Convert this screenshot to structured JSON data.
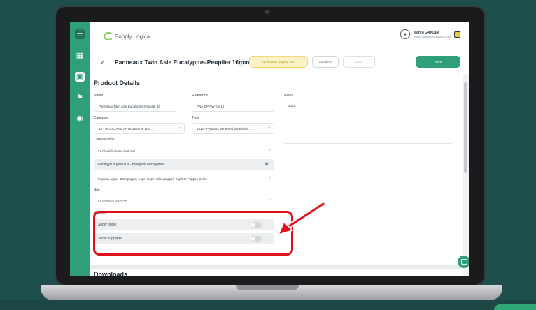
{
  "app": {
    "logo_text": "Supply Logica",
    "user_name": "Marco GANDINI",
    "user_email": "marco.gandini@example.com"
  },
  "colors": {
    "accent": "#2e9f79",
    "background": "#1f4f4c",
    "highlight": "#e0101a"
  },
  "sidebar": {
    "icons": [
      "menu-icon",
      "grid-icon",
      "basket-icon",
      "flag-icon",
      "globe-icon"
    ]
  },
  "header": {
    "back_label": "<",
    "title": "Panneaux Twin Asie Eucalyptus-Peuplier 16mm",
    "warning_pill": "Verification request sent",
    "suppliers_button": "Suppliers",
    "save_secondary": "Save",
    "save_button": "Save"
  },
  "product_details": {
    "section_title": "Product Details",
    "name_label": "Name",
    "name_value": "Panneaux Twin Asie Eucalyptus-Peuplier 16",
    "reference_label": "Reference",
    "reference_value": "PNA-CP-TW-AS-16",
    "notes_label": "Notes",
    "notes_value": "NULL",
    "category_label": "Category",
    "category_value": "44 - WOOD AND ARTICLES OF WO...",
    "type_label": "Type",
    "type_value": "4412 - Plywood, veneered panels an...",
    "classification_label": "Classification",
    "classification_value": "2x Classifications selected",
    "classification_items": [
      "Eucalyptus globulus - Bluegum eucalyptus",
      "Populus nigra - Zitterpappel; Aspe; Espe; Silberpappel; Euphrat-Pappel; Schw..."
    ],
    "site_label": "Site",
    "site_value": "LEADER PLYWOOD",
    "visibility_label": "Visibility",
    "show_origin_label": "Show origin",
    "show_origin": false,
    "show_suppliers_label": "Show suppliers",
    "show_suppliers": false,
    "downloads_title": "Downloads"
  }
}
